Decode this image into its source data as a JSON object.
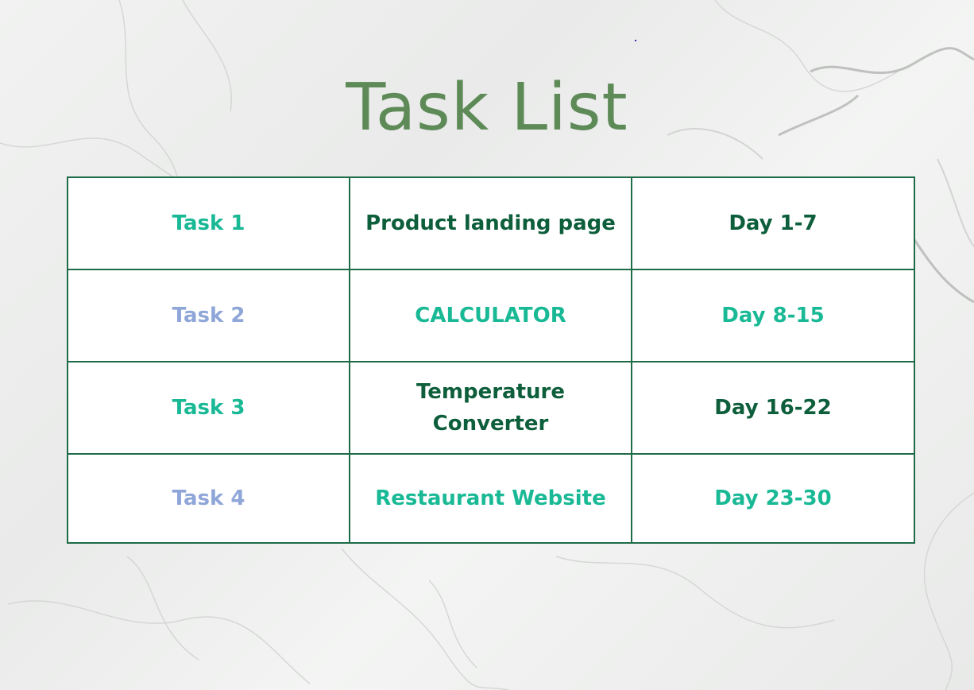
{
  "title": "Task List",
  "colors": {
    "title": "#5e8a58",
    "teal": "#19b996",
    "dark_green": "#0d5e3b",
    "periwinkle": "#8fa6d8",
    "border": "#1e6b48"
  },
  "tasks": [
    {
      "task": "Task 1",
      "project": "Product landing page",
      "days": "Day 1-7"
    },
    {
      "task": "Task 2",
      "project": "CALCULATOR",
      "days": "Day 8-15"
    },
    {
      "task": "Task 3",
      "project": "Temperature Converter",
      "days": "Day 16-22"
    },
    {
      "task": "Task 4",
      "project": "Restaurant Website",
      "days": "Day 23-30"
    }
  ]
}
